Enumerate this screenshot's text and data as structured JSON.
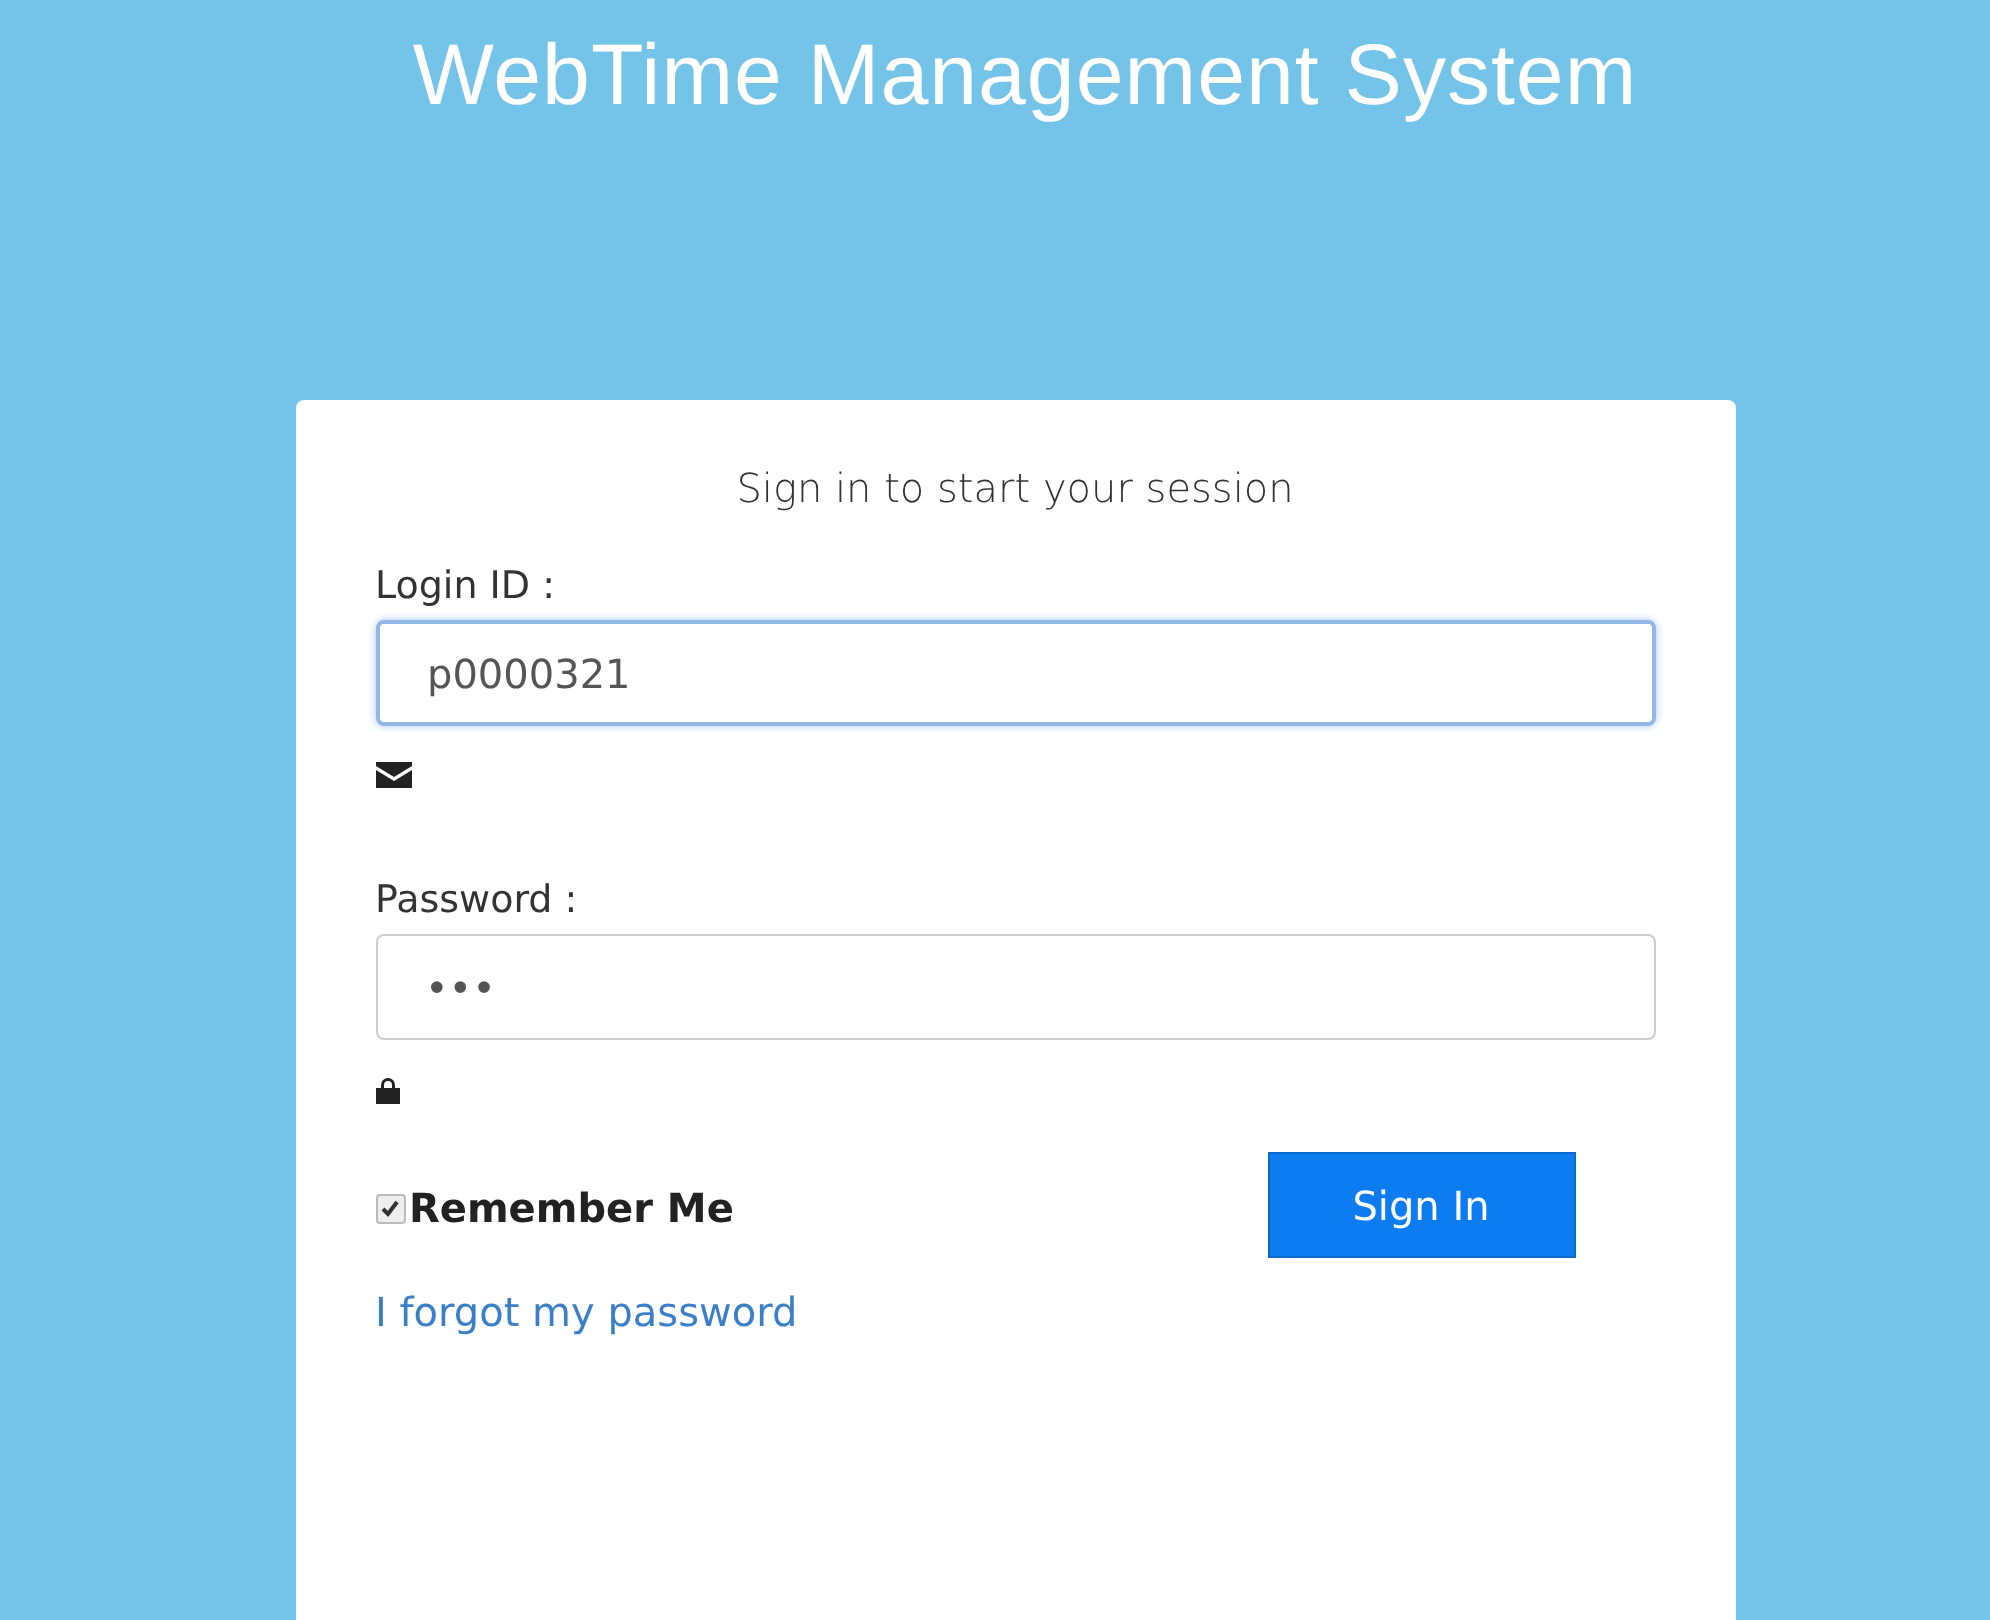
{
  "title": "WebTime Management System",
  "card": {
    "heading": "Sign in to start your session"
  },
  "fields": [
    {
      "kind": "text",
      "label": "Login ID :",
      "value": "p0000321",
      "focused": true
    },
    {
      "kind": "password",
      "label": "Password :",
      "value": "•••",
      "focused": false
    }
  ],
  "remember": {
    "label": "Remember Me",
    "checked": true
  },
  "sign_in_button": "Sign In",
  "forgot_link": "I forgot my password"
}
